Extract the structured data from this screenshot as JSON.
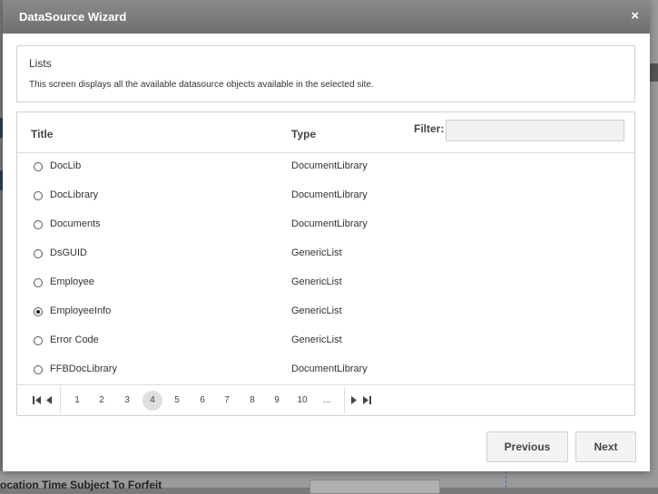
{
  "background": {
    "bottom_text": "ocation Time Subject To Forfeit"
  },
  "dialog": {
    "title": "DataSource Wizard",
    "close_glyph": "×"
  },
  "info": {
    "title": "Lists",
    "description": "This screen displays all the available datasource objects available in the selected site."
  },
  "grid": {
    "columns": {
      "title": "Title",
      "type": "Type"
    },
    "filter": {
      "label": "Filter:",
      "value": "",
      "placeholder": ""
    },
    "rows": [
      {
        "title": "DocLib",
        "type": "DocumentLibrary",
        "selected": false
      },
      {
        "title": "DocLibrary",
        "type": "DocumentLibrary",
        "selected": false
      },
      {
        "title": "Documents",
        "type": "DocumentLibrary",
        "selected": false
      },
      {
        "title": "DsGUID",
        "type": "GenericList",
        "selected": false
      },
      {
        "title": "Employee",
        "type": "GenericList",
        "selected": false
      },
      {
        "title": "EmployeeInfo",
        "type": "GenericList",
        "selected": true
      },
      {
        "title": "Error Code",
        "type": "GenericList",
        "selected": false
      },
      {
        "title": "FFBDocLibrary",
        "type": "DocumentLibrary",
        "selected": false
      }
    ]
  },
  "pager": {
    "pages": [
      "1",
      "2",
      "3",
      "4",
      "5",
      "6",
      "7",
      "8",
      "9",
      "10",
      "..."
    ],
    "current_page": "4",
    "icons": [
      "first-page-icon",
      "prev-page-icon",
      "next-page-icon",
      "last-page-icon"
    ]
  },
  "buttons": {
    "previous": "Previous",
    "next": "Next"
  },
  "colors": {
    "header_bg": "#7a7a7a",
    "accent_dashed": "#3b6fd1"
  }
}
